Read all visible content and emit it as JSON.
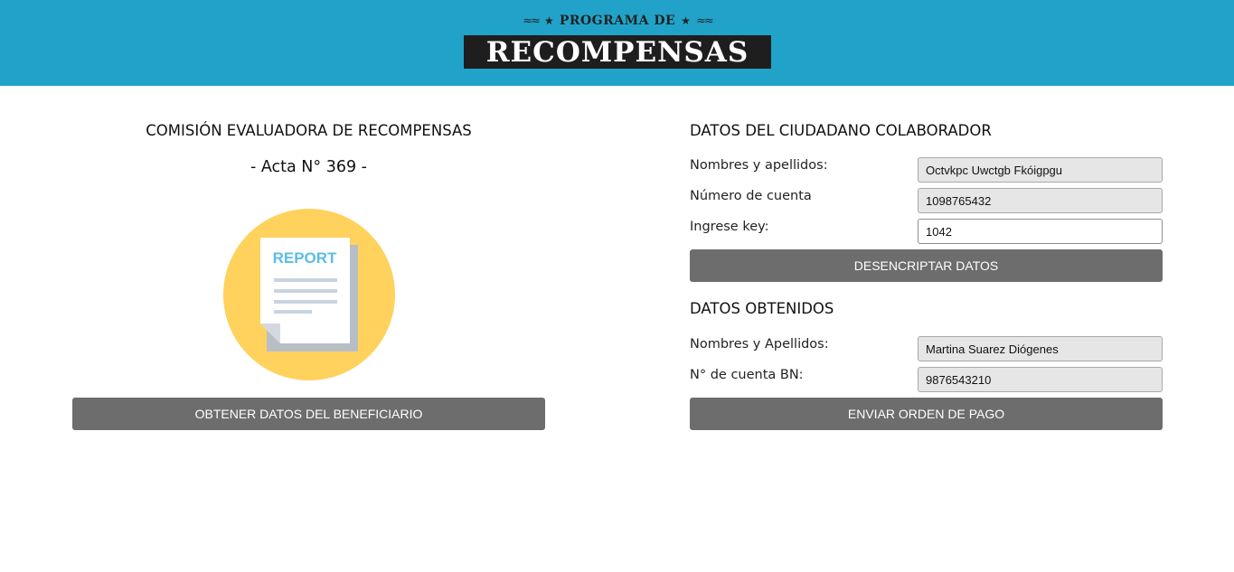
{
  "header": {
    "logo_top": "PROGRAMA DE",
    "logo_main": "RECOMPENSAS",
    "bg_color": "#21a3c9"
  },
  "left": {
    "title": "COMISIÓN EVALUADORA DE RECOMPENSAS",
    "acta": "- Acta N° 369 -",
    "report_label": "REPORT",
    "button": "OBTENER DATOS DEL BENEFICIARIO"
  },
  "colaborador": {
    "title": "DATOS DEL CIUDADANO COLABORADOR",
    "name_label": "Nombres y apellidos:",
    "name_value": "Octvkpc Uwctgb Fkóigpgu",
    "account_label": "Número de cuenta",
    "account_value": "1098765432",
    "key_label": "Ingrese key:",
    "key_value": "1042",
    "button": "DESENCRIPTAR DATOS"
  },
  "obtenidos": {
    "title": "DATOS OBTENIDOS",
    "name_label": "Nombres y Apellidos:",
    "name_value": "Martina Suarez Diógenes",
    "account_label": "N° de cuenta BN:",
    "account_value": "9876543210",
    "button": "ENVIAR ORDEN DE PAGO"
  },
  "icons": {
    "report": "report-document-icon",
    "wing": "wing-icon",
    "star": "star-icon"
  }
}
